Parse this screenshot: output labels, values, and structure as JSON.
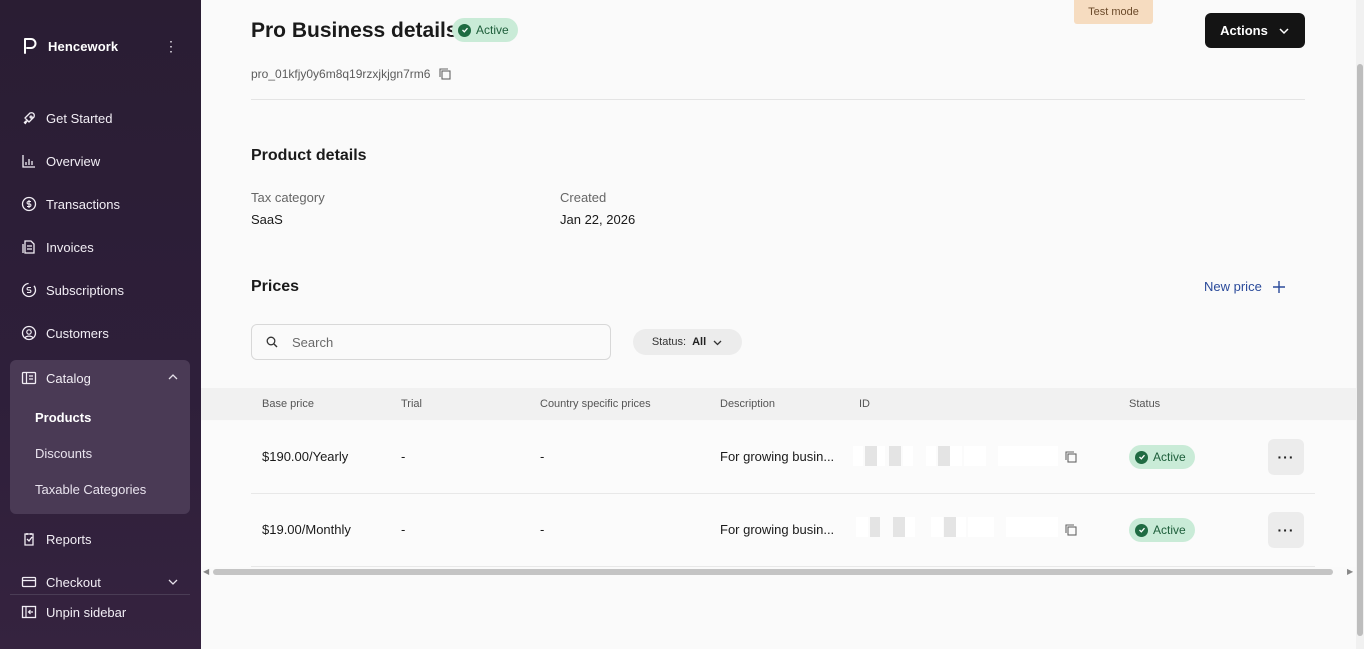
{
  "sidebar": {
    "brand": "Hencework",
    "menu_icon": "kebab-icon",
    "items": [
      {
        "label": "Get Started",
        "icon": "rocket-icon"
      },
      {
        "label": "Overview",
        "icon": "bar-chart-icon"
      },
      {
        "label": "Transactions",
        "icon": "dollar-circle-icon"
      },
      {
        "label": "Invoices",
        "icon": "invoice-icon"
      },
      {
        "label": "Subscriptions",
        "icon": "subscription-icon"
      },
      {
        "label": "Customers",
        "icon": "user-circle-icon"
      }
    ],
    "catalog": {
      "label": "Catalog",
      "icon": "catalog-icon",
      "expanded": true,
      "children": [
        "Products",
        "Discounts",
        "Taxable Categories"
      ],
      "active": "Products"
    },
    "reports": "Reports",
    "checkout": "Checkout",
    "unpin": "Unpin sidebar"
  },
  "header": {
    "title": "Pro Business details",
    "status": "Active",
    "test_mode": "Test mode",
    "actions_label": "Actions",
    "product_id": "pro_01kfjy0y6m8q19rzxjkjgn7rm6"
  },
  "product_details": {
    "title": "Product details",
    "tax_category_label": "Tax category",
    "tax_category_value": "SaaS",
    "created_label": "Created",
    "created_value": "Jan 22, 2026"
  },
  "prices": {
    "title": "Prices",
    "new_price": "New price",
    "search_placeholder": "Search",
    "status_filter_label": "Status:",
    "status_filter_value": "All",
    "columns": [
      "Base price",
      "Trial",
      "Country specific prices",
      "Description",
      "ID",
      "Status"
    ],
    "rows": [
      {
        "base_price": "$190.00/Yearly",
        "trial": "-",
        "country_prices": "-",
        "description": "For growing busin...",
        "status": "Active"
      },
      {
        "base_price": "$19.00/Monthly",
        "trial": "-",
        "country_prices": "-",
        "description": "For growing busin...",
        "status": "Active"
      }
    ]
  },
  "colors": {
    "sidebar_bg": "#2e1f3a",
    "active_badge_bg": "#c9ebd7",
    "primary_button": "#141414",
    "link": "#2a4a9a",
    "test_mode_bg": "#f6dcc0"
  }
}
